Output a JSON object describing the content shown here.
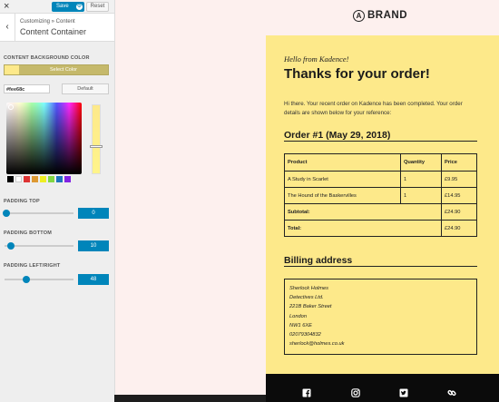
{
  "sidebar": {
    "close_icon": "×",
    "save_label": "Save",
    "reset_label": "Reset",
    "back_icon": "‹",
    "breadcrumb": "Customizing » Content",
    "section_title": "Content Container",
    "bg_color_label": "CONTENT BACKGROUND COLOR",
    "select_color_label": "Select Color",
    "hex_value": "#fee68c",
    "default_label": "Default",
    "palette": [
      "#000000",
      "#ffffff",
      "#dd3333",
      "#dd9933",
      "#eeee22",
      "#81d742",
      "#1e73be",
      "#8224e3"
    ],
    "padding_top": {
      "label": "PADDING TOP",
      "value": "0",
      "fraction": 0
    },
    "padding_bottom": {
      "label": "PADDING BOTTOM",
      "value": "10",
      "fraction": 0.08
    },
    "padding_lr": {
      "label": "PADDING LEFT/RIGHT",
      "value": "48",
      "fraction": 0.33
    },
    "accent": "#0085ba"
  },
  "preview": {
    "brand_mark": "A",
    "brand_name": "BRAND",
    "hello": "Hello from Kadence!",
    "thanks": "Thanks for your order!",
    "intro": "Hi there. Your recent order on Kadence has been completed. Your order details are shown below for your reference:",
    "order_heading": "Order #1 (May 29, 2018)",
    "table": {
      "headers": [
        "Product",
        "Quantity",
        "Price"
      ],
      "rows": [
        [
          "A Study in Scarlet",
          "1",
          "£9.95"
        ],
        [
          "The Hound of the Baskervilles",
          "1",
          "£14.95"
        ]
      ],
      "subtotal_label": "Subtotal:",
      "subtotal_value": "£24.90",
      "total_label": "Total:",
      "total_value": "£24.90"
    },
    "billing_heading": "Billing address",
    "address": [
      "Sherlock Holmes",
      "Detectives Ltd.",
      "221B Baker Street",
      "London",
      "NW1 6XE",
      "02079304832",
      "sherlock@holmes.co.uk"
    ],
    "email_bg": "#fde98a",
    "social_icons": [
      "facebook-icon",
      "instagram-icon",
      "twitter-icon",
      "link-icon"
    ]
  }
}
